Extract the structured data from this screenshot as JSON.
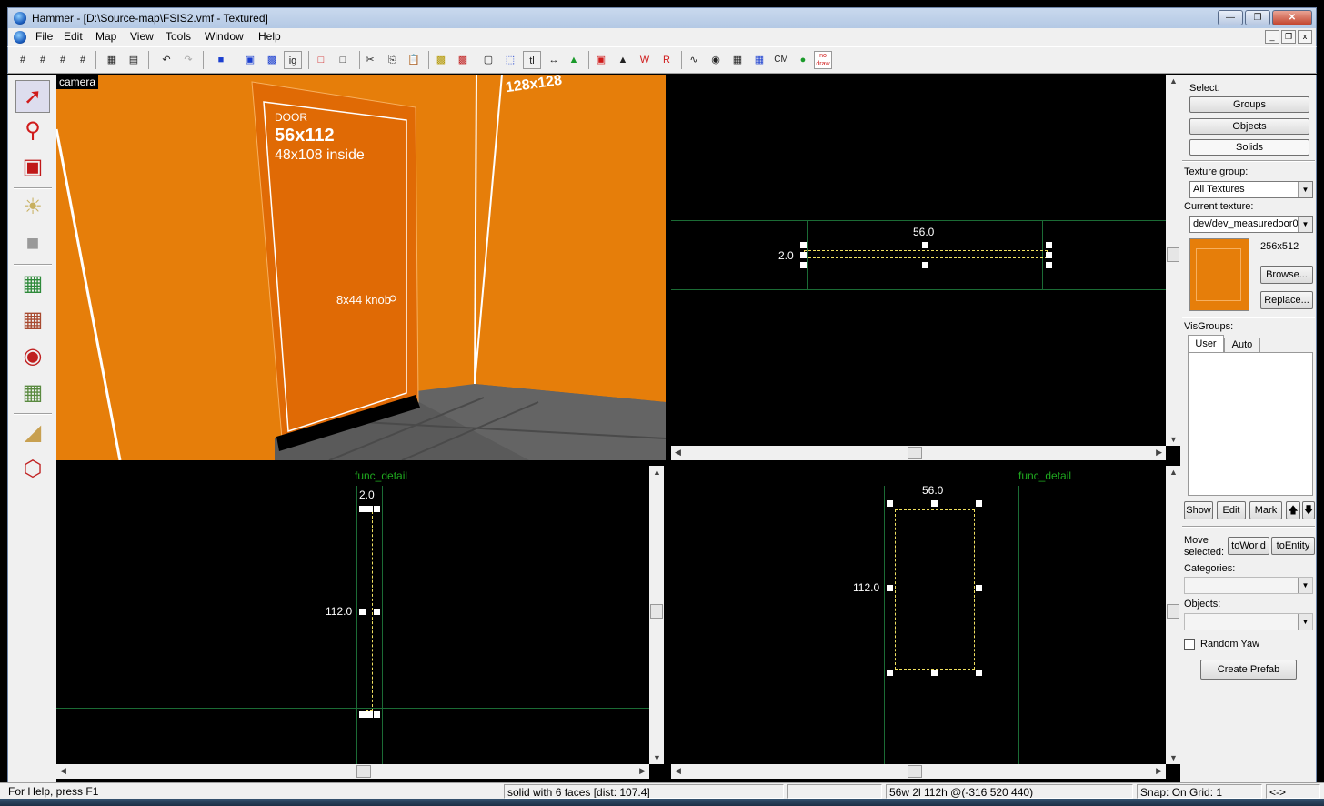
{
  "window": {
    "title": "Hammer - [D:\\Source-map\\FSIS2.vmf - Textured]",
    "controls": [
      "minimize",
      "restore",
      "close"
    ]
  },
  "menu": [
    "File",
    "Edit",
    "Map",
    "View",
    "Tools",
    "Window",
    "Help"
  ],
  "toolbar": {
    "texture_lock_label": "tl",
    "ignore_groups_label": "ig",
    "cordon_label": "CM",
    "nodraw_label": "no draw"
  },
  "tools": [
    "selection-tool",
    "magnify-tool",
    "camera-tool",
    "entity-tool",
    "block-tool",
    "texture-application-tool",
    "apply-current-texture-tool",
    "decal-tool",
    "overlay-tool",
    "clipping-tool",
    "vertex-tool"
  ],
  "viewports": {
    "camera": {
      "label": "camera",
      "door_title": "DOOR",
      "door_size": "56x112",
      "door_inside": "48x108 inside",
      "knob": "8x44 knob",
      "wall_measure": "128x128"
    },
    "top": {
      "width_label": "56.0",
      "depth_label": "2.0"
    },
    "side": {
      "entity": "func_detail",
      "depth_label": "2.0",
      "height_label": "112.0"
    },
    "front": {
      "entity": "func_detail",
      "width_label": "56.0",
      "height_label": "112.0"
    }
  },
  "panel": {
    "select_label": "Select:",
    "select_buttons": [
      "Groups",
      "Objects",
      "Solids"
    ],
    "texture_group_label": "Texture group:",
    "texture_group_value": "All Textures",
    "current_texture_label": "Current texture:",
    "current_texture_value": "dev/dev_measuredoor0",
    "texture_size": "256x512",
    "browse_label": "Browse...",
    "replace_label": "Replace...",
    "visgroups_label": "VisGroups:",
    "visgroup_tabs": [
      "User",
      "Auto"
    ],
    "show_label": "Show",
    "edit_label": "Edit",
    "mark_label": "Mark",
    "move_selected_label": "Move selected:",
    "to_world_label": "toWorld",
    "to_entity_label": "toEntity",
    "categories_label": "Categories:",
    "objects_label": "Objects:",
    "random_yaw_label": "Random Yaw",
    "random_yaw_checked": false,
    "create_prefab_label": "Create Prefab"
  },
  "status": {
    "help": "For Help, press F1",
    "selection": "solid with 6 faces  [dist: 107.4]",
    "size": "56w 2l 112h @(-316 520 440)",
    "snap": "Snap: On Grid: 1",
    "extra": "<->"
  },
  "colors": {
    "camera_bg": "#e67e0a",
    "grid_line": "#2a2a2a",
    "entity_text": "#1fa91f",
    "selection_outline": "#f0e060"
  }
}
